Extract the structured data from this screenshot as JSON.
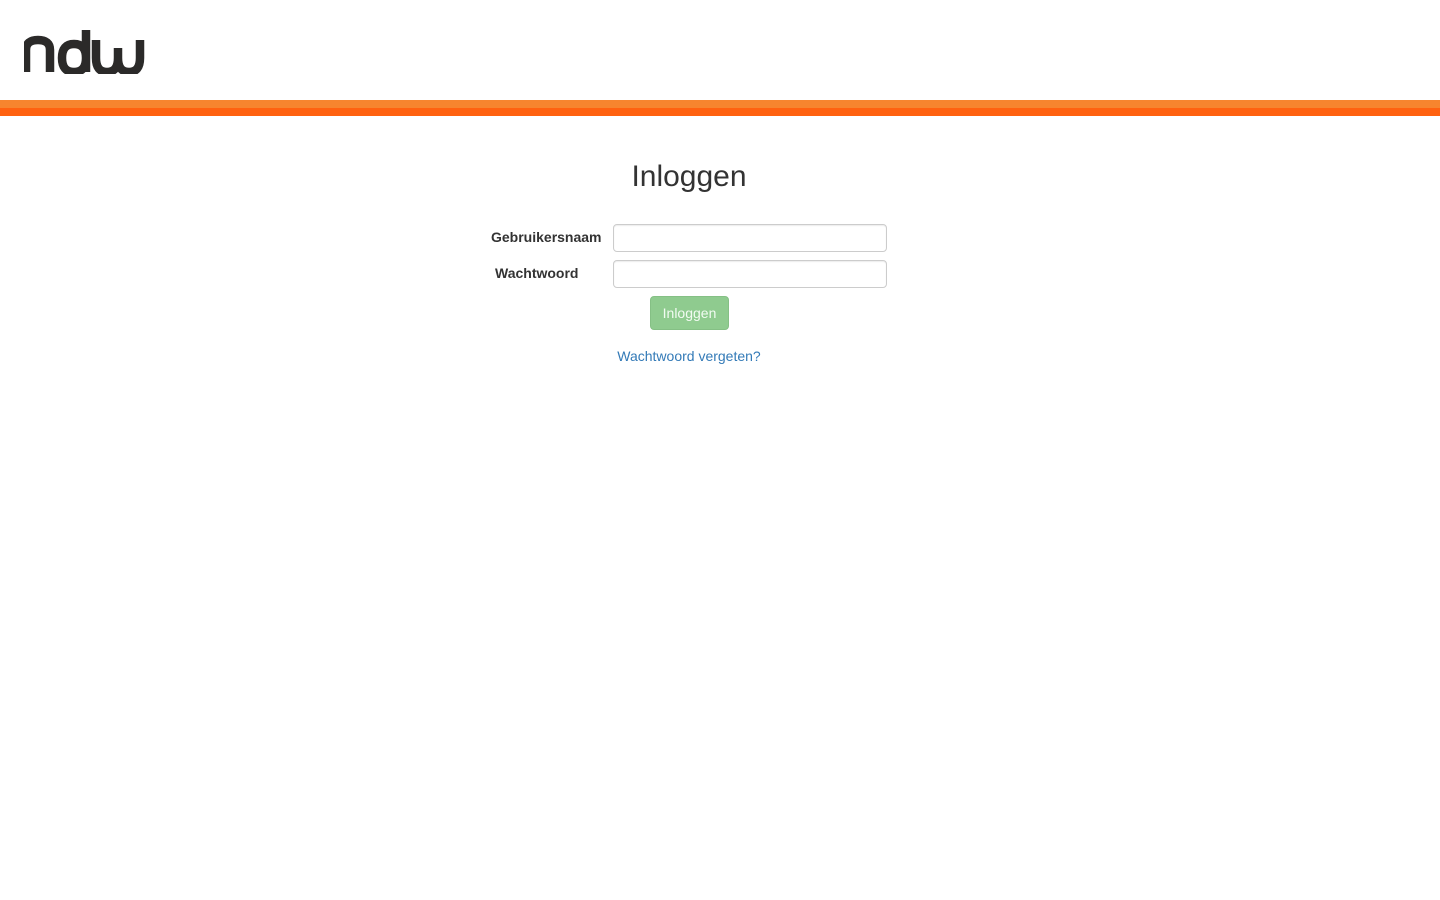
{
  "header": {
    "logo_text": "ndw",
    "brand_color": "#2b2a29",
    "stripe_colors": [
      "#f7852e",
      "#ff6210"
    ]
  },
  "login": {
    "title": "Inloggen",
    "username_label": "Gebruikersnaam",
    "username_value": "",
    "password_label": "Wachtwoord",
    "password_value": "",
    "submit_label": "Inloggen",
    "submit_color": "#8fcb8f",
    "forgot_label": "Wachtwoord vergeten?",
    "link_color": "#337ab7"
  }
}
